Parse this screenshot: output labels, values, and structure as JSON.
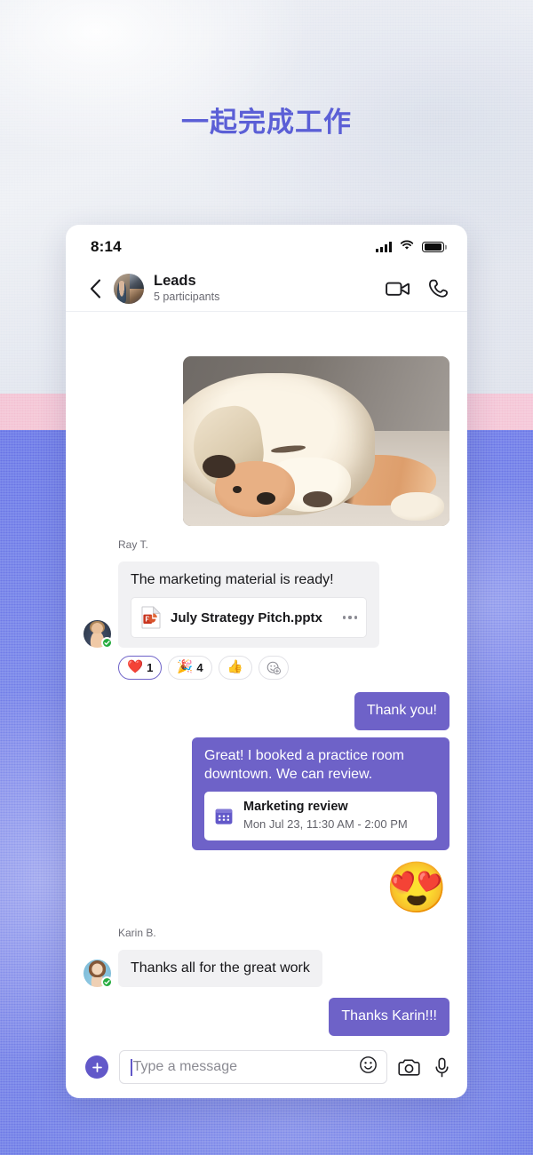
{
  "page": {
    "headline": "一起完成工作",
    "headline_color": "#5b5fd6",
    "background": {
      "top": "#e7eaf1",
      "band": "#f4c3d4",
      "bottom": "#7280e9"
    }
  },
  "phone": {
    "status_bar": {
      "time": "8:14",
      "signal_icon": "cellular-signal-icon",
      "wifi_icon": "wifi-icon",
      "battery_icon": "battery-full-icon"
    },
    "chat_header": {
      "back_icon": "chevron-left-icon",
      "avatar": "group-avatar",
      "title": "Leads",
      "subtitle": "5 participants",
      "video_call_icon": "video-camera-icon",
      "audio_call_icon": "phone-handset-icon"
    },
    "messages": [
      {
        "type": "image",
        "direction": "in",
        "alt": "sleeping labrador dog with plush toy"
      },
      {
        "type": "text",
        "direction": "in",
        "sender": "Ray T.",
        "presence": "available",
        "text": "The marketing material is ready!",
        "attachment": {
          "icon": "powerpoint-file-icon",
          "name": "July Strategy Pitch.pptx",
          "menu_icon": "more-options-icon"
        },
        "reactions": [
          {
            "emoji": "❤️",
            "name": "heart-reaction",
            "count": "1",
            "selected": true
          },
          {
            "emoji": "🎉",
            "name": "party-popper-reaction",
            "count": "4",
            "selected": false
          },
          {
            "emoji": "👍",
            "name": "thumbs-up-reaction",
            "count": "",
            "selected": false
          },
          {
            "emoji": "",
            "name": "add-reaction-button",
            "count": "",
            "selected": false
          }
        ]
      },
      {
        "type": "text",
        "direction": "out",
        "text": "Thank you!"
      },
      {
        "type": "text",
        "direction": "out",
        "text": "Great! I booked a practice room downtown. We can review.",
        "event": {
          "icon": "calendar-icon",
          "title": "Marketing review",
          "when": "Mon Jul 23, 11:30 AM - 2:00 PM"
        }
      },
      {
        "type": "emoji",
        "direction": "out",
        "emoji": "😍",
        "name": "heart-eyes-emoji-message"
      },
      {
        "type": "text",
        "direction": "in",
        "sender": "Karin B.",
        "presence": "available",
        "text": "Thanks all for the great work"
      },
      {
        "type": "text",
        "direction": "out",
        "text": "Thanks Karin!!!"
      }
    ],
    "composer": {
      "add_icon": "plus-icon",
      "input_value": "",
      "placeholder": "Type a message",
      "emoji_icon": "smiley-icon",
      "camera_icon": "camera-icon",
      "mic_icon": "microphone-icon"
    }
  }
}
